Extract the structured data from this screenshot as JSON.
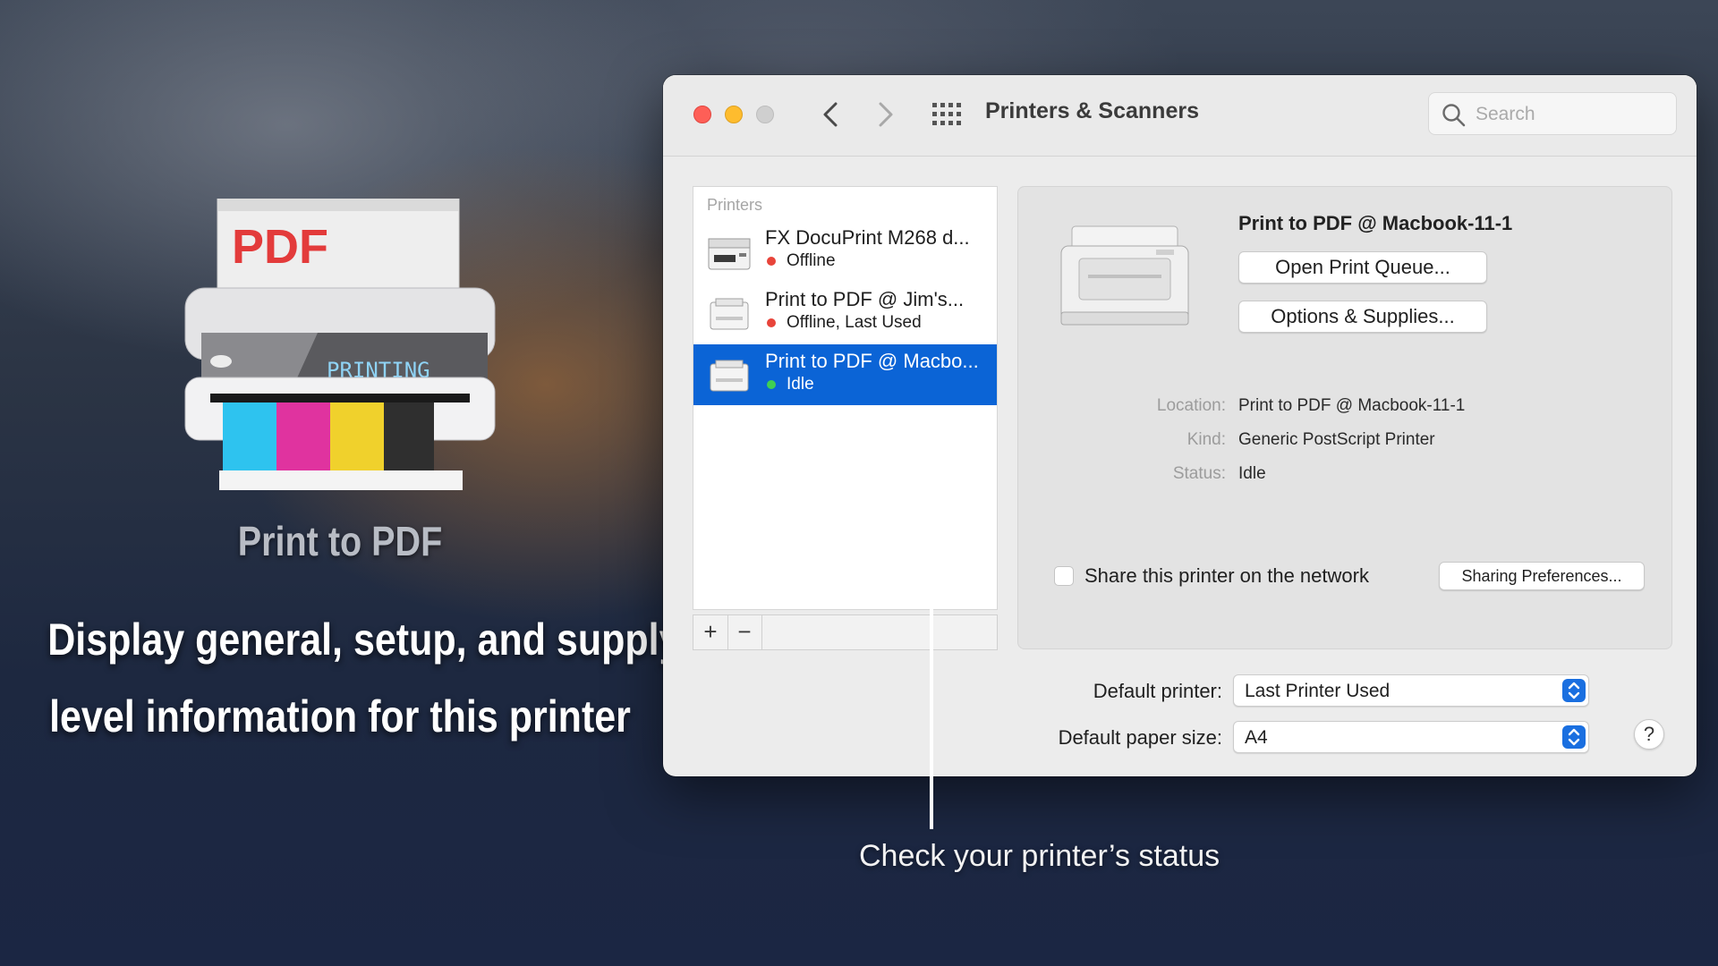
{
  "promo": {
    "app_name": "Print to PDF",
    "tagline_line1": "Display general, setup, and supply",
    "tagline_line2": "level information for this printer",
    "icon_paper_text": "PDF",
    "icon_display_text": "PRINTING"
  },
  "window": {
    "title": "Printers & Scanners",
    "search_placeholder": "Search"
  },
  "printers_list": {
    "header": "Printers",
    "items": [
      {
        "name": "FX DocuPrint M268 d...",
        "status": "Offline",
        "status_color": "#e8443a",
        "selected": false
      },
      {
        "name": "Print to PDF @ Jim's...",
        "status": "Offline, Last Used",
        "status_color": "#e8443a",
        "selected": false
      },
      {
        "name": "Print to PDF @ Macbo...",
        "status": "Idle",
        "status_color": "#3fcf52",
        "selected": true
      }
    ],
    "add_label": "+",
    "remove_label": "−"
  },
  "detail": {
    "title": "Print to PDF @ Macbook-11-1",
    "open_queue_label": "Open Print Queue...",
    "options_label": "Options & Supplies...",
    "location_label": "Location:",
    "location_value": "Print to PDF @ Macbook-11-1",
    "kind_label": "Kind:",
    "kind_value": "Generic PostScript Printer",
    "status_label": "Status:",
    "status_value": "Idle",
    "share_label": "Share this printer on the network",
    "share_checked": false,
    "sharing_prefs_label": "Sharing Preferences..."
  },
  "defaults": {
    "printer_label": "Default printer:",
    "printer_value": "Last Printer Used",
    "paper_label": "Default paper size:",
    "paper_value": "A4",
    "help_label": "?"
  },
  "callout": {
    "text": "Check your printer’s status"
  },
  "colors": {
    "accent": "#0b64d6",
    "offline": "#e8443a",
    "idle": "#3fcf52"
  }
}
